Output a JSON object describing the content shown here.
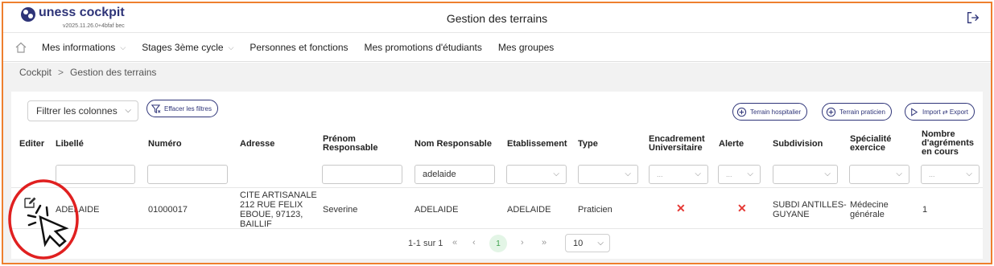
{
  "header": {
    "brand": "uness cockpit",
    "version": "v2025.11.26.0+4bfaf bec",
    "page_title": "Gestion des terrains"
  },
  "nav": {
    "items": [
      {
        "label": "Mes informations",
        "has_dropdown": true
      },
      {
        "label": "Stages 3ème cycle",
        "has_dropdown": true
      },
      {
        "label": "Personnes et fonctions",
        "has_dropdown": false
      },
      {
        "label": "Mes promotions d'étudiants",
        "has_dropdown": false
      },
      {
        "label": "Mes groupes",
        "has_dropdown": false
      }
    ]
  },
  "breadcrumb": {
    "root": "Cockpit",
    "separator": ">",
    "current": "Gestion des terrains"
  },
  "toolbar": {
    "filter_columns": "Filtrer les colonnes",
    "clear_filters": "Effacer les filtres",
    "hospital_btn": "Terrain hospitalier",
    "practitioner_btn": "Terrain praticien",
    "import_export_btn": "Import ⇄ Export"
  },
  "table": {
    "headers": {
      "editer": "Editer",
      "libelle": "Libellé",
      "numero": "Numéro",
      "adresse": "Adresse",
      "prenom": [
        "Prénom",
        "Responsable"
      ],
      "nom_resp": "Nom Responsable",
      "etablissement": "Etablissement",
      "type": "Type",
      "encadrement": [
        "Encadrement",
        "Universitaire"
      ],
      "alerte": "Alerte",
      "subdivision": "Subdivision",
      "specialite": [
        "Spécialité",
        "exercice"
      ],
      "agrements": [
        "Nombre",
        "d'agréments",
        "en cours"
      ]
    },
    "filters": {
      "nom_responsable": "adelaide",
      "placeholder_dots": "..."
    },
    "rows": [
      {
        "libelle": "ADELAIDE",
        "numero": "01000017",
        "adresse": [
          "CITE ARTISANALE",
          "212 RUE FELIX",
          "EBOUE, 97123,",
          "BAILLIF"
        ],
        "prenom": "Severine",
        "nom": "ADELAIDE",
        "etablissement": "ADELAIDE",
        "type": "Praticien",
        "encadrement": "✕",
        "alerte": "✕",
        "subdivision": [
          "SUBDI ANTILLES-",
          "GUYANE"
        ],
        "specialite": [
          "Médecine",
          "générale"
        ],
        "agrements": "1"
      }
    ]
  },
  "pagination": {
    "summary": "1-1 sur 1",
    "first": "«",
    "prev": "‹",
    "current_page": "1",
    "next": "›",
    "last": "»",
    "page_size": "10"
  },
  "colors": {
    "frame": "#ee7f2e",
    "brand": "#2e3478",
    "annotation": "#e02020",
    "error": "#e53935",
    "active_page": "#3fa34d"
  }
}
